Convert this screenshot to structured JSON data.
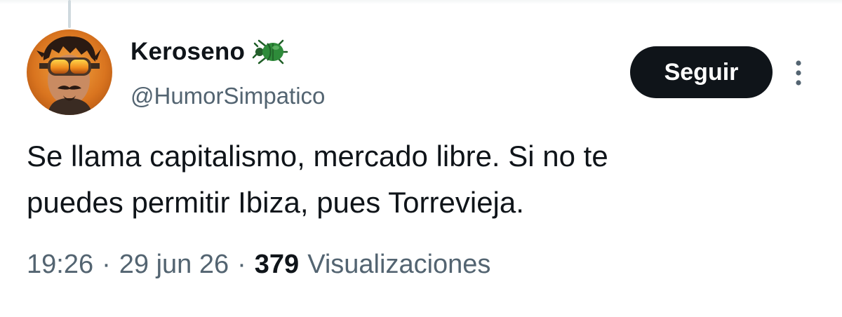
{
  "tweet": {
    "author": {
      "display_name": "Keroseno",
      "badge_icon": "beetle-icon",
      "handle": "@HumorSimpatico",
      "avatar": "avatar-man-with-goggles"
    },
    "follow_label": "Seguir",
    "more_icon": "more-vertical-icon",
    "text": "Se llama capitalismo, mercado libre. Si no te\npuedes permitir Ibiza, pues Torrevieja.",
    "meta": {
      "time": "19:26",
      "separator": "·",
      "date": "29 jun 26",
      "views_count": "379",
      "views_label": "Visualizaciones"
    }
  },
  "colors": {
    "text_primary": "#0f1419",
    "text_secondary": "#536471",
    "button_bg": "#0f1419",
    "button_text": "#ffffff",
    "beetle": "#2e8b3a"
  }
}
